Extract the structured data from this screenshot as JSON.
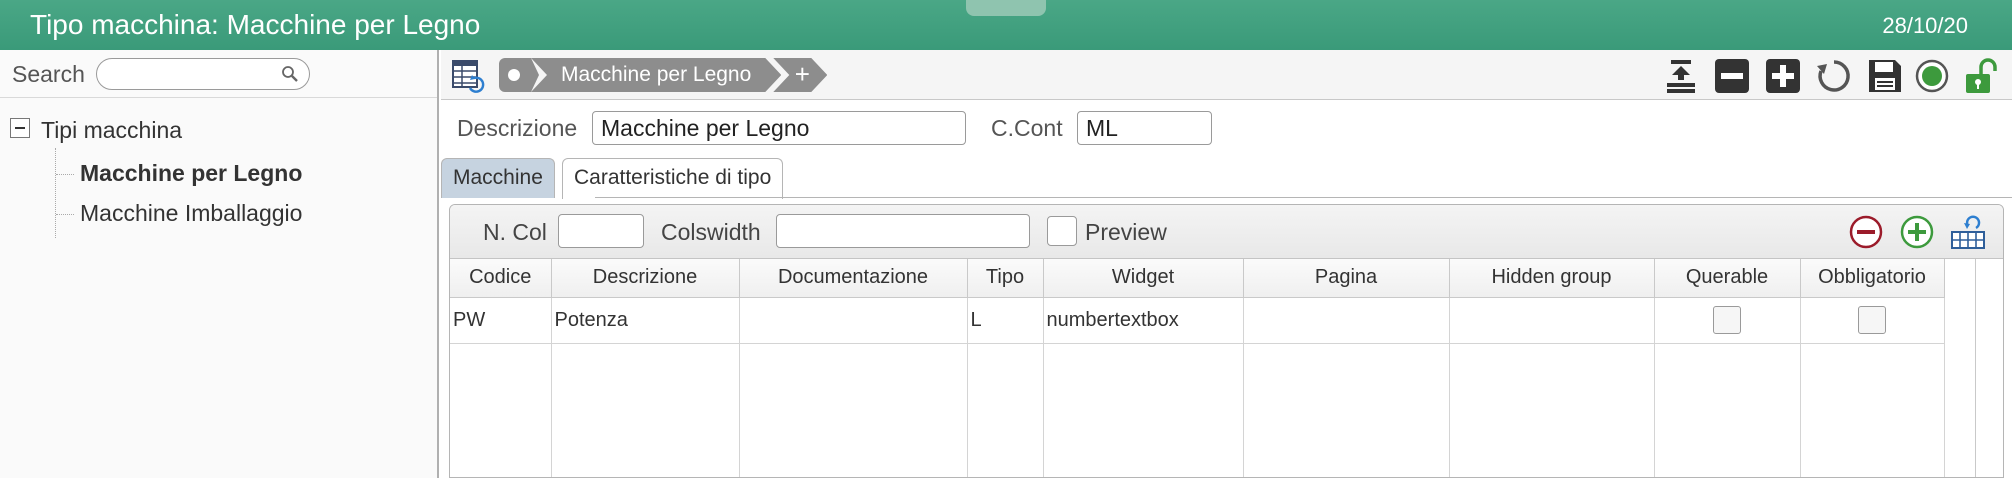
{
  "window": {
    "title": "Tipo macchina: Macchine per Legno",
    "date": "28/10/20"
  },
  "search": {
    "label": "Search",
    "value": ""
  },
  "tree": {
    "root": "Tipi macchina",
    "children": [
      {
        "label": "Macchine per Legno",
        "selected": true
      },
      {
        "label": "Macchine Imballaggio",
        "selected": false
      }
    ]
  },
  "breadcrumb": {
    "items": [
      "Macchine per Legno"
    ],
    "add_symbol": "+"
  },
  "toolbar_icons": [
    "grid-nav-icon",
    "import-icon",
    "remove-icon",
    "add-icon",
    "refresh-icon",
    "save-icon",
    "status-circle-icon",
    "unlock-icon"
  ],
  "form": {
    "descrizione_label": "Descrizione",
    "descrizione_value": "Macchine per Legno",
    "ccont_label": "C.Cont",
    "ccont_value": "ML"
  },
  "tabs": [
    {
      "label": "Macchine",
      "active": false
    },
    {
      "label": "Caratteristiche di tipo",
      "active": true
    }
  ],
  "panel": {
    "ncol_label": "N. Col",
    "ncol_value": "",
    "colswidth_label": "Colswidth",
    "colswidth_value": "",
    "preview_label": "Preview",
    "preview_checked": false
  },
  "grid": {
    "columns": [
      "Codice",
      "Descrizione",
      "Documentazione",
      "Tipo",
      "Widget",
      "Pagina",
      "Hidden group",
      "Querable",
      "Obbligatorio"
    ],
    "rows": [
      {
        "codice": "PW",
        "descrizione": "Potenza",
        "documentazione": "",
        "tipo": "L",
        "widget": "numbertextbox",
        "pagina": "",
        "hidden_group": "",
        "querable": false,
        "obbligatorio": false
      }
    ]
  },
  "colors": {
    "titlebar": "#3f9f7e",
    "breadcrumb": "#8d8d8d",
    "tab_inactive": "#c6d3e0",
    "remove_red": "#9b1b2a",
    "add_green": "#3d9a3d",
    "lock_green": "#3d9a3d"
  }
}
